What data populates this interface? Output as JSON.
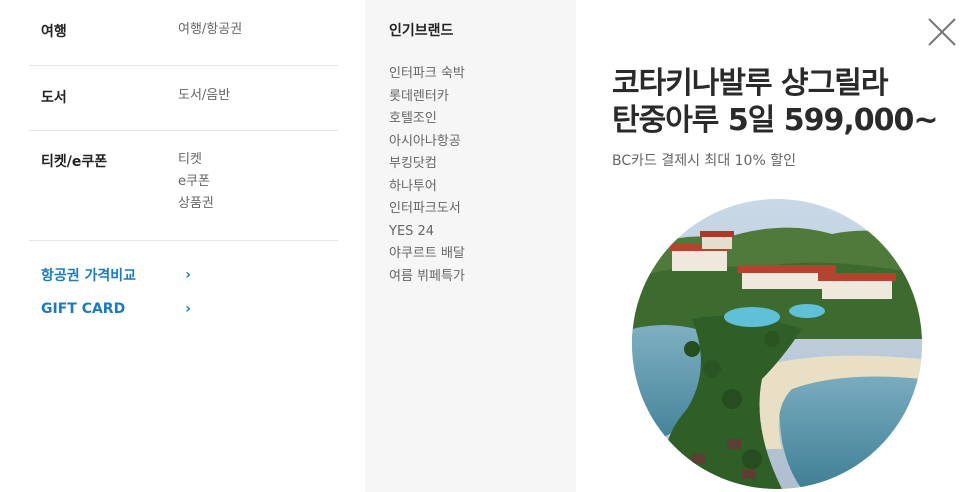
{
  "categories": [
    {
      "title": "여행",
      "links": [
        "여행/항공권"
      ]
    },
    {
      "title": "도서",
      "links": [
        "도서/음반"
      ]
    },
    {
      "title": "티켓/e쿠폰",
      "links": [
        "티켓",
        "e쿠폰",
        "상품권"
      ]
    }
  ],
  "extra_links": [
    {
      "label": "항공권 가격비교",
      "icon": "chevron-right-icon"
    },
    {
      "label": "GIFT CARD",
      "icon": "chevron-right-icon"
    }
  ],
  "popular_brands": {
    "title": "인기브랜드",
    "items": [
      "인터파크 숙박",
      "롯데렌터카",
      "호텔조인",
      "아시아나항공",
      "부킹닷컴",
      "하나투어",
      "인터파크도서",
      "YES 24",
      "야쿠르트 배달",
      "여름 뷔페특가"
    ]
  },
  "promo": {
    "line1": "코타키나발루 샹그릴라",
    "line2": "탄중아루 5일 599,000~",
    "sub": "BC카드 결제시 최대 10% 할인"
  },
  "colors": {
    "link_blue": "#1a7bbf",
    "mid_bg": "#f6f6f6"
  }
}
